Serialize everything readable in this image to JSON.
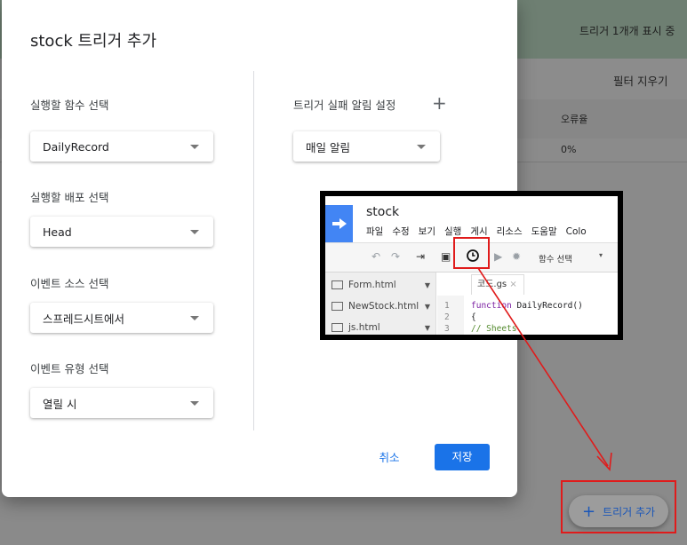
{
  "background": {
    "showing_text": "트리거 1개개 표시 중",
    "clear_filter": "필터 지우기",
    "column_error": "오류율",
    "row_error_value": "0%"
  },
  "dialog": {
    "title": "stock 트리거 추가",
    "function_label": "실행할 함수 선택",
    "function_value": "DailyRecord",
    "deployment_label": "실행할 배포 선택",
    "deployment_value": "Head",
    "event_source_label": "이벤트 소스 선택",
    "event_source_value": "스프레드시트에서",
    "event_type_label": "이벤트 유형 선택",
    "event_type_value": "열릴 시",
    "failure_label": "트리거 실패 알림 설정",
    "failure_value": "매일 알림",
    "cancel": "취소",
    "save": "저장"
  },
  "inset": {
    "project": "stock",
    "menus": [
      "파일",
      "수정",
      "보기",
      "실행",
      "게시",
      "리소스",
      "도움말",
      "Colo"
    ],
    "function_select": "함수 선택",
    "files": [
      "Form.html",
      "NewStock.html",
      "js.html"
    ],
    "tab": "코드.gs",
    "lines": [
      "1",
      "2",
      "3"
    ],
    "code_keyword": "function",
    "code_rest": " DailyRecord()",
    "code_line2": "{",
    "code_comment": "  // Sheets"
  },
  "fab": {
    "label": "트리거 추가"
  },
  "colors": {
    "accent": "#1a73e8",
    "annotation": "#e01b1b"
  }
}
